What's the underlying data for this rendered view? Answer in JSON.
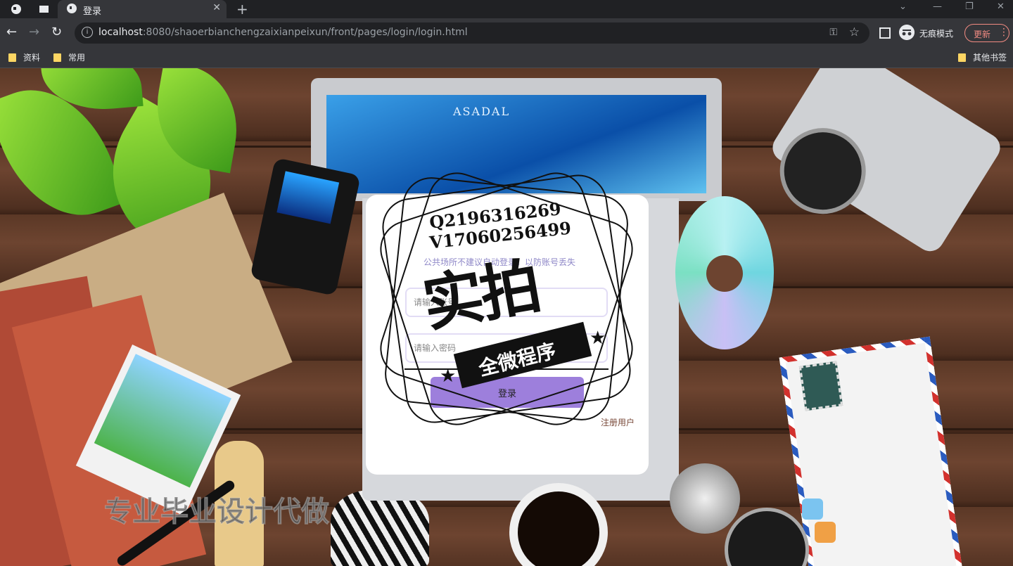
{
  "browser": {
    "tab_title": "登录",
    "url_host": "localhost",
    "url_rest": ":8080/shaoerbianchengzaixianpeixun/front/pages/login/login.html",
    "incognito_label": "无痕模式",
    "update_label": "更新",
    "bookmarks": [
      "资料",
      "常用"
    ],
    "other_bookmarks": "其他书签"
  },
  "login": {
    "notice": "公共场所不建议自动登录，以防账号丢失",
    "username_placeholder": "请输入账号",
    "password_placeholder": "请输入密码",
    "login_button": "登录",
    "register_link": "注册用户"
  },
  "background": {
    "laptop_brand": "ASADAL"
  },
  "watermark": {
    "contact_q": "Q2196316269",
    "contact_v": "V17060256499",
    "big_text": "实拍",
    "ribbon_text": "全微程序",
    "bottom_text": "专业毕业设计代做"
  },
  "colors": {
    "accent": "#9d7fdc",
    "notice": "#8f88c8",
    "register": "#7a4a3a"
  }
}
